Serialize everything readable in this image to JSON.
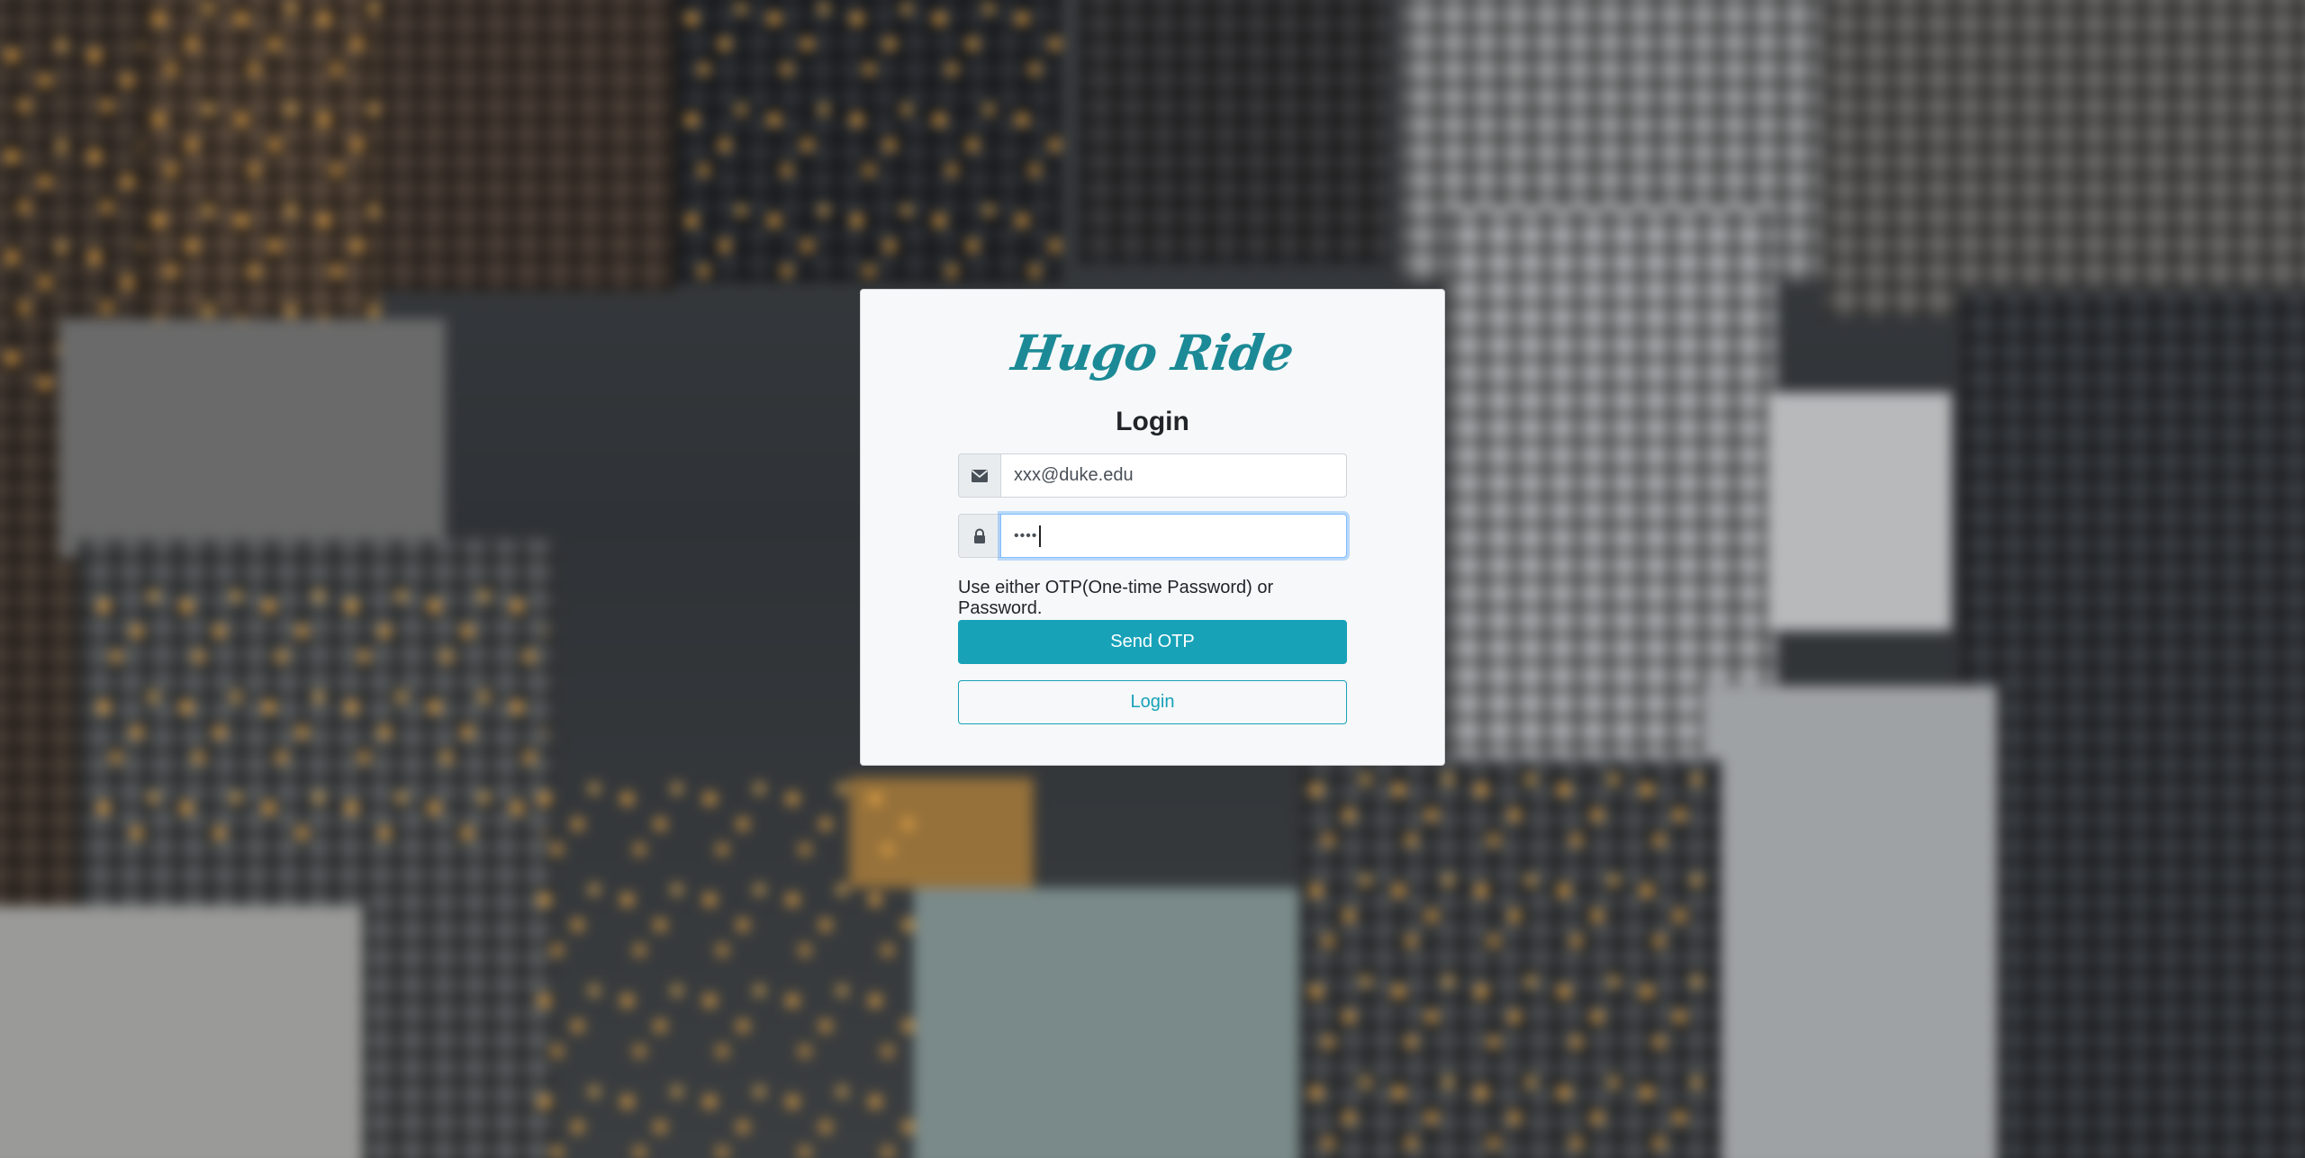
{
  "background": {
    "description_icon": "blurred-city-skyline-image"
  },
  "card": {
    "brand_logo": "Hugo Ride",
    "title": "Login",
    "email": {
      "icon": "envelope-icon",
      "value": "xxx@duke.edu"
    },
    "password": {
      "icon": "lock-icon",
      "masked_value": "••••"
    },
    "hint": "Use either OTP(One-time Password) or Password.",
    "send_otp_label": "Send OTP",
    "login_label": "Login"
  },
  "colors": {
    "accent": "#17a2b8",
    "brand": "#1b8a96",
    "card_bg": "#f7f8f9"
  }
}
